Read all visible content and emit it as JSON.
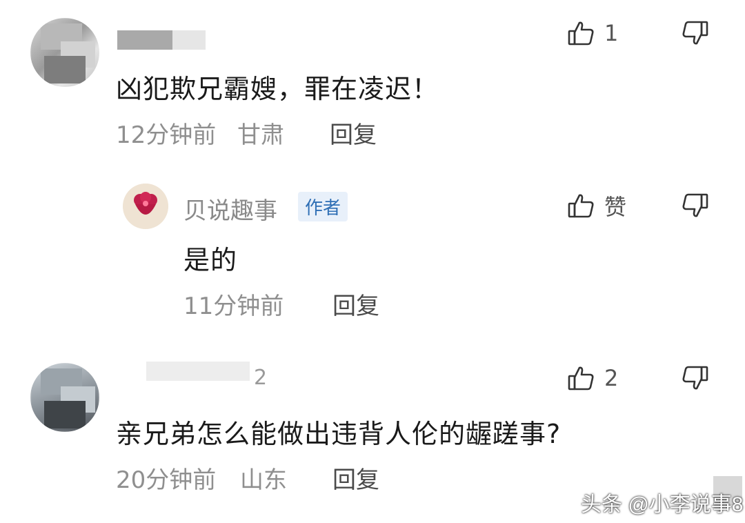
{
  "comments": [
    {
      "text": "凶犯欺兄霸嫂，罪在凌迟！",
      "time": "12分钟前",
      "location": "甘肃",
      "reply_label": "回复",
      "likes": "1"
    },
    {
      "author": "贝说趣事",
      "badge": "作者",
      "text": "是的",
      "time": "11分钟前",
      "reply_label": "回复",
      "likes": "赞"
    },
    {
      "name_fragment": "2",
      "text": "亲兄弟怎么能做出违背人伦的龌蹉事?",
      "time": "20分钟前",
      "location": "山东",
      "reply_label": "回复",
      "likes": "2"
    }
  ],
  "watermark": "头条 @小李说事8",
  "icons": {
    "like": "thumbs-up-icon",
    "dislike": "thumbs-down-icon"
  },
  "colors": {
    "meta_gray": "#8f8f8f",
    "badge_blue": "#2f6fb5",
    "badge_bg": "#e8f0fa"
  }
}
